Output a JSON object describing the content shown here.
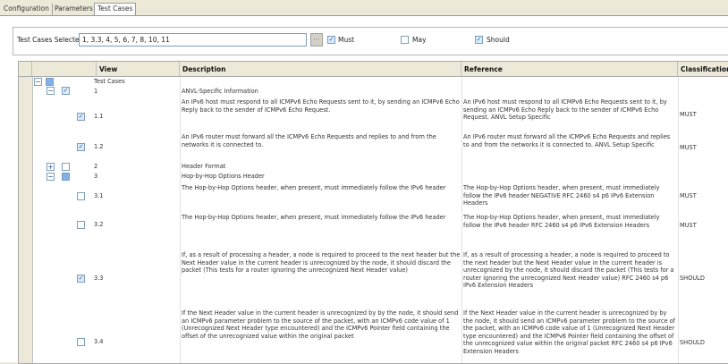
{
  "tabs": [
    {
      "label": "Configuration",
      "active": false
    },
    {
      "label": "Parameters",
      "active": false
    },
    {
      "label": "Test Cases",
      "active": true
    }
  ],
  "filter": {
    "label": "Test Cases Selected",
    "value": "1, 3.3, 4, 5, 6, 7, 8, 10, 11",
    "options": [
      {
        "label": "Must",
        "checked": true
      },
      {
        "label": "May",
        "checked": false
      },
      {
        "label": "Should",
        "checked": true
      }
    ]
  },
  "grid": {
    "columns": [
      "View",
      "Description",
      "Reference",
      "Classification"
    ],
    "rows": [
      {
        "view": "Test Cases",
        "description": "",
        "reference": "",
        "classification": "",
        "state": "partial"
      },
      {
        "view": "1",
        "description": "ANVL-Specific Information",
        "reference": "",
        "classification": "",
        "state": "checked"
      },
      {
        "view": "1.1",
        "description": "An IPv6 host must respond to all ICMPv6 Echo Requests sent to it, by sending an ICMPv6 Echo Reply back to the sender of ICMPv6 Echo Request.",
        "reference": "An IPv6 host must respond to all ICMPv6 Echo Requests sent to it, by sending an ICMPv6 Echo Reply back to the sender of ICMPv6 Echo Request. ANVL Setup Specific",
        "classification": "MUST",
        "state": "checked"
      },
      {
        "view": "1.2",
        "description": "An IPv6 router must forward all the ICMPv6 Echo Requests and replies to and from the networks it is connected to.",
        "reference": "An IPv6 router must forward all the ICMPv6 Echo Requests and replies to and from the networks it is connected to. ANVL Setup Specific",
        "classification": "MUST",
        "state": "checked"
      },
      {
        "view": "2",
        "description": "Header Format",
        "reference": "",
        "classification": "",
        "state": "unchecked"
      },
      {
        "view": "3",
        "description": "Hop-by-Hop Options Header",
        "reference": "",
        "classification": "",
        "state": "partial"
      },
      {
        "view": "3.1",
        "description": "The Hop-by-Hop Options header, when present, must immediately follow the IPv6 header",
        "reference": "The Hop-by-Hop Options header, when present, must immediately follow the IPv6 header NEGATIVE RFC 2460 s4 p6 IPv6 Extension Headers",
        "classification": "MUST",
        "state": "unchecked"
      },
      {
        "view": "3.2",
        "description": "The Hop-by-Hop Options header, when present, must immediately follow the IPv6 header",
        "reference": "The Hop-by-Hop Options header, when present, must immediately follow the IPv6 header RFC 2460 s4 p6 IPv6 Extension Headers",
        "classification": "MUST",
        "state": "unchecked"
      },
      {
        "view": "3.3",
        "description": "If, as a result of processing a header, a node is required to proceed to the next header but the Next Header value in the current header is unrecognized by the node, it should discard the packet (This tests for a router ignoring the unrecognized Next Header value)",
        "reference": "If, as a result of processing a header, a node is required to proceed to the next header but the Next Header value in the current header is unrecognized by the node, it should discard the packet (This tests for a router ignoring the unrecognized Next Header value) RFC 2460 s4 p6 IPv6 Extension Headers",
        "classification": "SHOULD",
        "state": "checked"
      },
      {
        "view": "3.4",
        "description": "If the Next Header value in the current header is unrecognized by by the node, it should send an ICMPv6 parameter problem to the source of the packet, with an ICMPv6 code value of 1 (Unrecognized Next Header type encountered) and the ICMPv6 Pointer field containing the offset of the unrecognized value within the original packet",
        "reference": "If the Next Header value in the current header is unrecognized by by the node, it should send an ICMPv6 parameter problem to the source of the packet, with an ICMPv6 code value of 1 (Unrecognized Next Header type encountered) and the ICMPv6 Pointer field containing the offset of the unrecognized value within the original packet RFC 2460 s4 p6 IPv6 Extension Headers",
        "classification": "SHOULD",
        "state": "unchecked"
      }
    ]
  }
}
